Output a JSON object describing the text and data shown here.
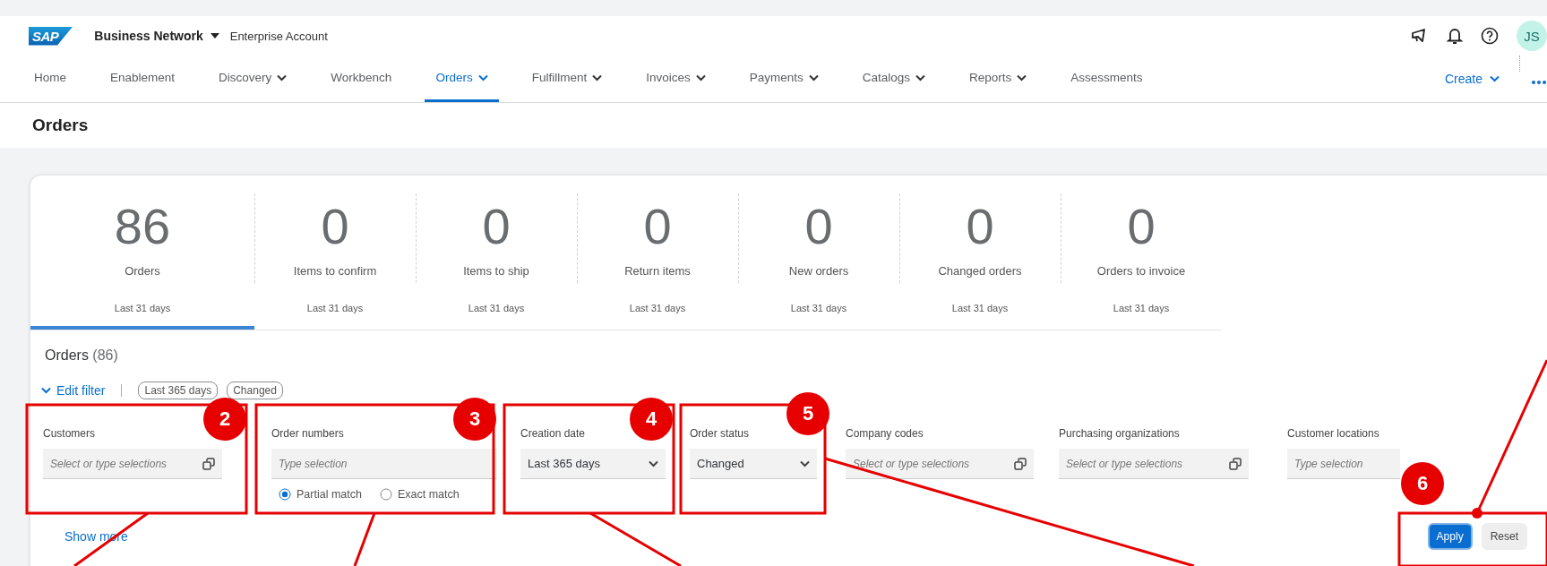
{
  "header": {
    "logo": "SAP",
    "product": "Business Network",
    "account": "Enterprise Account",
    "avatar": "JS"
  },
  "nav": [
    {
      "label": "Home",
      "dropdown": false,
      "selected": false
    },
    {
      "label": "Enablement",
      "dropdown": false,
      "selected": false
    },
    {
      "label": "Discovery",
      "dropdown": true,
      "selected": false
    },
    {
      "label": "Workbench",
      "dropdown": false,
      "selected": false
    },
    {
      "label": "Orders",
      "dropdown": true,
      "selected": true
    },
    {
      "label": "Fulfillment",
      "dropdown": true,
      "selected": false
    },
    {
      "label": "Invoices",
      "dropdown": true,
      "selected": false
    },
    {
      "label": "Payments",
      "dropdown": true,
      "selected": false
    },
    {
      "label": "Catalogs",
      "dropdown": true,
      "selected": false
    },
    {
      "label": "Reports",
      "dropdown": true,
      "selected": false
    },
    {
      "label": "Assessments",
      "dropdown": false,
      "selected": false
    }
  ],
  "create": "Create",
  "page_title": "Orders",
  "tiles": [
    {
      "count": "86",
      "label": "Orders",
      "period": "Last 31 days",
      "selected": true
    },
    {
      "count": "0",
      "label": "Items to confirm",
      "period": "Last 31 days",
      "selected": false
    },
    {
      "count": "0",
      "label": "Items to ship",
      "period": "Last 31 days",
      "selected": false
    },
    {
      "count": "0",
      "label": "Return items",
      "period": "Last 31 days",
      "selected": false
    },
    {
      "count": "0",
      "label": "New orders",
      "period": "Last 31 days",
      "selected": false
    },
    {
      "count": "0",
      "label": "Changed orders",
      "period": "Last 31 days",
      "selected": false
    },
    {
      "count": "0",
      "label": "Orders to invoice",
      "period": "Last 31 days",
      "selected": false
    }
  ],
  "list_title": "Orders",
  "list_count": "(86)",
  "edit_filter": "Edit filter",
  "chips": [
    "Last 365 days",
    "Changed"
  ],
  "filters": [
    {
      "kind": "multi",
      "label": "Customers",
      "placeholder": "Select or type selections"
    },
    {
      "kind": "text",
      "label": "Order numbers",
      "placeholder": "Type selection",
      "options": [
        {
          "label": "Partial match",
          "selected": true
        },
        {
          "label": "Exact match",
          "selected": false
        }
      ]
    },
    {
      "kind": "select",
      "label": "Creation date",
      "value": "Last 365 days"
    },
    {
      "kind": "select",
      "label": "Order status",
      "value": "Changed"
    },
    {
      "kind": "multi",
      "label": "Company codes",
      "placeholder": "Select or type selections"
    },
    {
      "kind": "multi",
      "label": "Purchasing organizations",
      "placeholder": "Select or type selections"
    },
    {
      "kind": "text",
      "label": "Customer locations",
      "placeholder": "Type selection"
    }
  ],
  "show_more": "Show more",
  "apply": "Apply",
  "reset": "Reset",
  "annotations": [
    {
      "label": "2"
    },
    {
      "label": "3"
    },
    {
      "label": "4"
    },
    {
      "label": "5"
    },
    {
      "label": "6"
    }
  ]
}
